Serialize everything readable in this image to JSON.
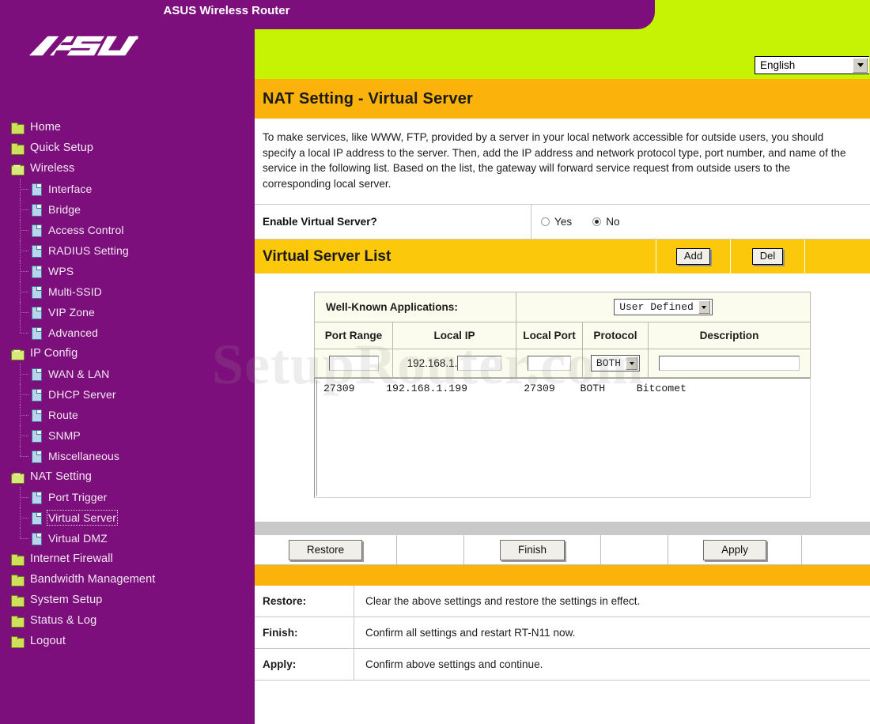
{
  "window": {
    "top_tab_title": "ASUS Wireless Router",
    "brand": "ASUS"
  },
  "header": {
    "language_selected": "English",
    "language_options": [
      "English"
    ]
  },
  "sidebar": {
    "items": [
      {
        "label": "Home",
        "level": 0,
        "icon": "folder-closed-icon",
        "selected": false
      },
      {
        "label": "Quick Setup",
        "level": 0,
        "icon": "folder-closed-icon",
        "selected": false
      },
      {
        "label": "Wireless",
        "level": 0,
        "icon": "folder-open-icon",
        "selected": false
      },
      {
        "label": "Interface",
        "level": 1,
        "icon": "page-icon",
        "selected": false
      },
      {
        "label": "Bridge",
        "level": 1,
        "icon": "page-icon",
        "selected": false
      },
      {
        "label": "Access Control",
        "level": 1,
        "icon": "page-icon",
        "selected": false
      },
      {
        "label": "RADIUS Setting",
        "level": 1,
        "icon": "page-icon",
        "selected": false
      },
      {
        "label": "WPS",
        "level": 1,
        "icon": "page-icon",
        "selected": false
      },
      {
        "label": "Multi-SSID",
        "level": 1,
        "icon": "page-icon",
        "selected": false
      },
      {
        "label": "VIP Zone",
        "level": 1,
        "icon": "page-icon",
        "selected": false
      },
      {
        "label": "Advanced",
        "level": 1,
        "icon": "page-icon",
        "selected": false,
        "last": true
      },
      {
        "label": "IP Config",
        "level": 0,
        "icon": "folder-open-icon",
        "selected": false
      },
      {
        "label": "WAN & LAN",
        "level": 1,
        "icon": "page-icon",
        "selected": false
      },
      {
        "label": "DHCP Server",
        "level": 1,
        "icon": "page-icon",
        "selected": false
      },
      {
        "label": "Route",
        "level": 1,
        "icon": "page-icon",
        "selected": false
      },
      {
        "label": "SNMP",
        "level": 1,
        "icon": "page-icon",
        "selected": false
      },
      {
        "label": "Miscellaneous",
        "level": 1,
        "icon": "page-icon",
        "selected": false,
        "last": true
      },
      {
        "label": "NAT Setting",
        "level": 0,
        "icon": "folder-open-icon",
        "selected": false
      },
      {
        "label": "Port Trigger",
        "level": 1,
        "icon": "page-icon",
        "selected": false
      },
      {
        "label": "Virtual Server",
        "level": 1,
        "icon": "page-icon",
        "selected": true
      },
      {
        "label": "Virtual DMZ",
        "level": 1,
        "icon": "page-icon",
        "selected": false,
        "last": true
      },
      {
        "label": "Internet Firewall",
        "level": 0,
        "icon": "folder-closed-icon",
        "selected": false
      },
      {
        "label": "Bandwidth Management",
        "level": 0,
        "icon": "folder-closed-icon",
        "selected": false
      },
      {
        "label": "System Setup",
        "level": 0,
        "icon": "folder-closed-icon",
        "selected": false
      },
      {
        "label": "Status & Log",
        "level": 0,
        "icon": "folder-closed-icon",
        "selected": false
      },
      {
        "label": "Logout",
        "level": 0,
        "icon": "folder-closed-icon",
        "selected": false
      }
    ]
  },
  "page": {
    "title": "NAT Setting - Virtual Server",
    "description": "To make services, like WWW, FTP, provided by a server in your local network accessible for outside users, you should specify a local IP address to the server. Then, add the IP address and network protocol type, port number, and name of the service in the following list. Based on the list, the gateway will forward service request from outside users to the corresponding local server."
  },
  "enable_row": {
    "label": "Enable Virtual Server?",
    "yes_label": "Yes",
    "no_label": "No",
    "selected": "No"
  },
  "list_header": {
    "title": "Virtual Server List",
    "add_label": "Add",
    "del_label": "Del"
  },
  "form": {
    "well_known_label": "Well-Known Applications:",
    "well_known_value": "User Defined",
    "well_known_options": [
      "User Defined"
    ],
    "columns": [
      "Port Range",
      "Local IP",
      "Local Port",
      "Protocol",
      "Description"
    ],
    "inputs": {
      "port_range": "",
      "local_ip_prefix": "192.168.1.",
      "local_ip_suffix": "",
      "local_port": "",
      "protocol": "BOTH",
      "protocol_options": [
        "BOTH"
      ],
      "description": ""
    }
  },
  "server_list": {
    "rows": [
      {
        "port_range": "27309",
        "local_ip": "192.168.1.199",
        "local_port": "27309",
        "protocol": "BOTH",
        "description": "Bitcomet",
        "text": "27309     192.168.1.199         27309    BOTH     Bitcomet"
      }
    ]
  },
  "buttons": {
    "restore": "Restore",
    "finish": "Finish",
    "apply": "Apply"
  },
  "help": {
    "rows": [
      {
        "key": "Restore:",
        "value": "Clear the above settings and restore the settings in effect."
      },
      {
        "key": "Finish:",
        "value": "Confirm all settings and restart RT-N11 now."
      },
      {
        "key": "Apply:",
        "value": "Confirm above settings and continue."
      }
    ]
  },
  "watermark": {
    "text": "SetupRouter.com"
  },
  "colors": {
    "purple": "#7d0f7d",
    "green": "#c6f203",
    "orange_title": "#fbb20a",
    "orange_list": "#fbc80c",
    "gray_band": "#c9c9c9"
  }
}
